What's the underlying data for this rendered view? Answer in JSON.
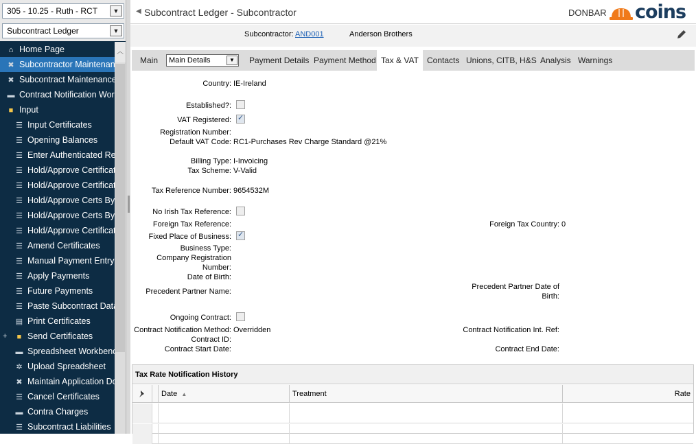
{
  "sidebar": {
    "company_select": "305 - 10.25 - Ruth - RCT",
    "module_select": "Subcontract Ledger",
    "items": [
      {
        "label": "Home Page",
        "icon": "home-icon",
        "level": 0
      },
      {
        "label": "Subcontractor Maintenance",
        "icon": "tools-icon",
        "level": 0,
        "active": true
      },
      {
        "label": "Subcontract Maintenance",
        "icon": "tools-icon",
        "level": 0
      },
      {
        "label": "Contract Notification Workbench",
        "icon": "workbench-icon",
        "level": 0
      },
      {
        "label": "Input",
        "icon": "folder-icon",
        "level": 0
      },
      {
        "label": "Input Certificates",
        "icon": "list-icon",
        "level": 1
      },
      {
        "label": "Opening Balances",
        "icon": "list-icon",
        "level": 1
      },
      {
        "label": "Enter Authenticated Returns",
        "icon": "list-icon",
        "level": 1
      },
      {
        "label": "Hold/Approve Certificates",
        "icon": "list-icon",
        "level": 1
      },
      {
        "label": "Hold/Approve Certificates",
        "icon": "list-icon",
        "level": 1
      },
      {
        "label": "Hold/Approve Certs By",
        "icon": "list-icon",
        "level": 1
      },
      {
        "label": "Hold/Approve Certs By",
        "icon": "list-icon",
        "level": 1
      },
      {
        "label": "Hold/Approve Certificates",
        "icon": "list-icon",
        "level": 1
      },
      {
        "label": "Amend Certificates",
        "icon": "list-icon",
        "level": 1
      },
      {
        "label": "Manual Payment Entry",
        "icon": "list-icon",
        "level": 1
      },
      {
        "label": "Apply Payments",
        "icon": "list-icon",
        "level": 1
      },
      {
        "label": "Future Payments",
        "icon": "list-icon",
        "level": 1
      },
      {
        "label": "Paste Subcontract Data",
        "icon": "list-icon",
        "level": 1
      },
      {
        "label": "Print Certificates",
        "icon": "document-icon",
        "level": 1
      },
      {
        "label": "Send Certificates",
        "icon": "folder-icon",
        "level": 1,
        "expandable": true
      },
      {
        "label": "Spreadsheet Workbench",
        "icon": "workbench-icon",
        "level": 1
      },
      {
        "label": "Upload Spreadsheet",
        "icon": "gear-icon",
        "level": 1
      },
      {
        "label": "Maintain Application Documents",
        "icon": "tools-icon",
        "level": 1
      },
      {
        "label": "Cancel Certificates",
        "icon": "list-icon",
        "level": 1
      },
      {
        "label": "Contra Charges",
        "icon": "workbench-icon",
        "level": 1
      },
      {
        "label": "Subcontract Liabilities",
        "icon": "list-icon",
        "level": 1
      }
    ]
  },
  "header": {
    "title": "Subcontract Ledger - Subcontractor",
    "user": "DONBAR",
    "logo_text": "coins"
  },
  "subbar": {
    "subcontractor_label": "Subcontractor:",
    "subcontractor_code": "AND001",
    "subcontractor_name": "Anderson Brothers"
  },
  "tabs": {
    "main": "Main",
    "details_select": "Main Details",
    "payment_details": "Payment Details",
    "payment_method": "Payment Method",
    "tax_vat": "Tax & VAT",
    "contacts": "Contacts",
    "unions": "Unions, CITB, H&S",
    "analysis": "Analysis",
    "warnings": "Warnings"
  },
  "form": {
    "country_label": "Country:",
    "country_value": "IE-Ireland",
    "established_label": "Established?:",
    "established_checked": false,
    "vat_registered_label": "VAT Registered:",
    "vat_registered_checked": true,
    "registration_number_label": "Registration Number:",
    "default_vat_code_label": "Default VAT Code:",
    "default_vat_code_value": "RC1-Purchases Rev Charge Standard @21%",
    "billing_type_label": "Billing Type:",
    "billing_type_value": "I-Invoicing",
    "tax_scheme_label": "Tax Scheme:",
    "tax_scheme_value": "V-Valid",
    "tax_reference_label": "Tax Reference Number:",
    "tax_reference_value": "9654532M",
    "no_irish_tax_ref_label": "No Irish Tax Reference:",
    "no_irish_tax_ref_checked": false,
    "foreign_tax_ref_label": "Foreign Tax Reference:",
    "foreign_tax_country_label": "Foreign Tax Country:",
    "foreign_tax_country_value": "0",
    "fixed_place_label": "Fixed Place of Business:",
    "fixed_place_checked": true,
    "business_type_label": "Business Type:",
    "company_reg_label_1": "Company Registration",
    "company_reg_label_2": "Number:",
    "date_of_birth_label": "Date of Birth:",
    "precedent_partner_name_label": "Precedent Partner Name:",
    "precedent_partner_dob_label_1": "Precedent Partner Date of",
    "precedent_partner_dob_label_2": "Birth:",
    "ongoing_contract_label": "Ongoing Contract:",
    "ongoing_contract_checked": false,
    "contract_notification_method_label": "Contract Notification Method:",
    "contract_notification_method_value": "Overridden",
    "contract_notification_int_ref_label": "Contract Notification Int. Ref:",
    "contract_id_label": "Contract ID:",
    "contract_start_date_label": "Contract Start Date:",
    "contract_end_date_label": "Contract End Date:"
  },
  "grid": {
    "title": "Tax Rate Notification History",
    "columns": [
      "Date",
      "Treatment",
      "Rate"
    ],
    "sort_indicator": "▲"
  },
  "colors": {
    "sidebar_bg": "#0d2c44",
    "active_item": "#2a75b8",
    "link": "#1a5fb4",
    "logo_orange": "#f07a1a",
    "logo_navy": "#1c3d5e"
  }
}
